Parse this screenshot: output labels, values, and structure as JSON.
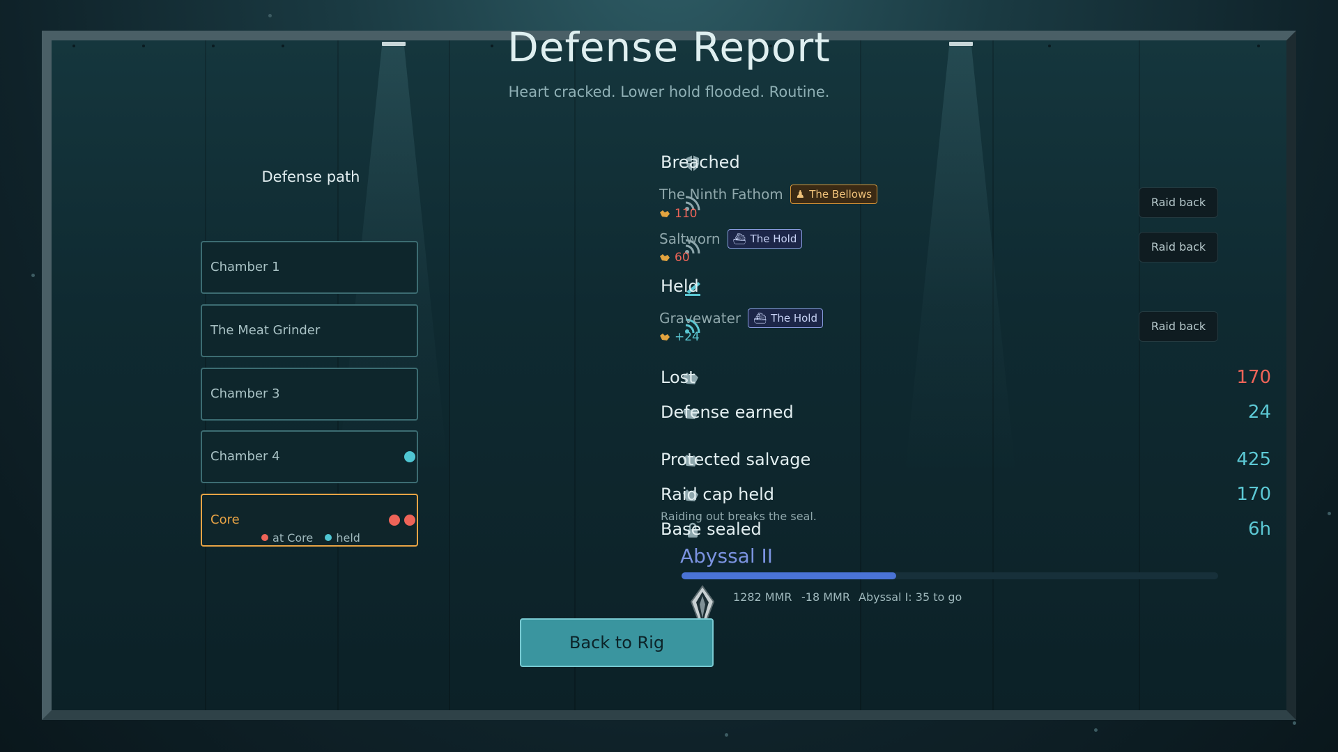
{
  "title": "Defense Report",
  "subtitle": "Heart cracked. Lower hold flooded. Routine.",
  "defense_path": {
    "heading": "Defense path",
    "chambers": [
      {
        "label": "Chamber 1"
      },
      {
        "label": "The Meat Grinder"
      },
      {
        "label": "Chamber 3"
      },
      {
        "label": "Chamber 4",
        "markers": [
          "held"
        ]
      },
      {
        "label": "Core",
        "markers": [
          "at Core",
          "at Core"
        ],
        "highlight": true
      }
    ],
    "legend": [
      {
        "label": "at Core",
        "color": "#ee6458"
      },
      {
        "label": "held",
        "color": "#4fc6d3"
      }
    ]
  },
  "breached": {
    "heading": "Breached",
    "icon": "shield-breach-icon",
    "raiders": [
      {
        "name": "The Ninth Fathom",
        "tag": "The Bellows",
        "tag_icon": "figure-icon",
        "amount": "110",
        "amount_color": "#ee6458",
        "button": "Raid back"
      },
      {
        "name": "Saltworn",
        "tag": "The Hold",
        "tag_icon": "ship-icon",
        "amount": "60",
        "amount_color": "#ee6458",
        "button": "Raid back"
      }
    ]
  },
  "held": {
    "heading": "Held",
    "icon": "cannon-icon",
    "raiders": [
      {
        "name": "Gravewater",
        "tag": "The Hold",
        "tag_icon": "ship-icon",
        "amount": "+24",
        "amount_color": "#5cc8d4",
        "button": "Raid back"
      }
    ]
  },
  "stats": {
    "lost": {
      "label": "Lost",
      "value": "170",
      "color": "#ee6458"
    },
    "defense_earned": {
      "label": "Defense earned",
      "value": "24",
      "color": "#5cc8d4"
    },
    "protected_salvage": {
      "label": "Protected salvage",
      "value": "425",
      "color": "#5cc8d4"
    },
    "raid_cap_held": {
      "label": "Raid cap held",
      "value": "170",
      "color": "#5cc8d4"
    },
    "base_sealed": {
      "label": "Base sealed",
      "value": "6h",
      "color": "#5cc8d4"
    }
  },
  "seal_note": "Raiding out breaks the seal.",
  "rank": {
    "name": "Abyssal II",
    "progress": 0.4,
    "mmr": "1282 MMR",
    "delta": "-18 MMR",
    "next": "Abyssal I: 35 to go"
  },
  "back_button": "Back to Rig"
}
